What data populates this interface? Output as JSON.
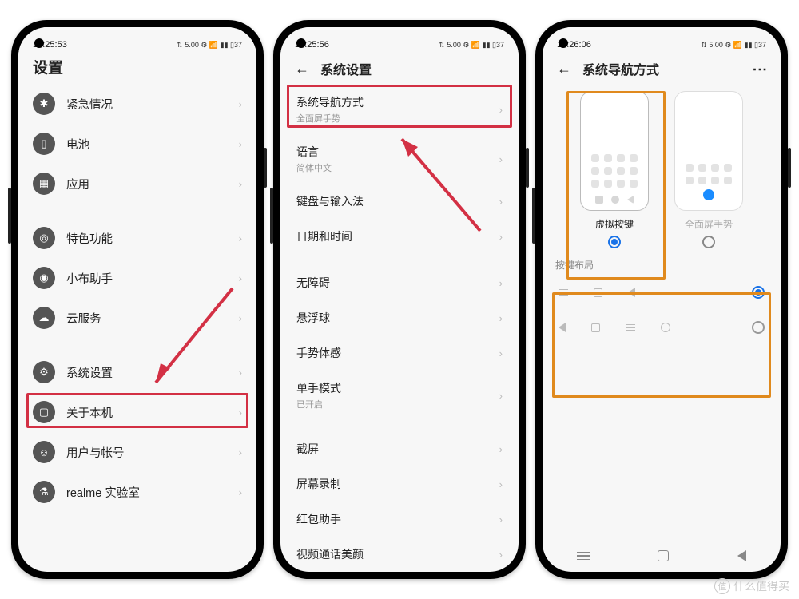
{
  "status": {
    "t1": "13:25:53",
    "t2": "13:25:56",
    "t3": "13:26:06",
    "icons": "⇅ 5.00 ⚙ 📶 ▮▮ ▯37"
  },
  "p1": {
    "title": "设置",
    "items": [
      {
        "icon": "✱",
        "label": "紧急情况"
      },
      {
        "icon": "▯",
        "label": "电池"
      },
      {
        "icon": "▦",
        "label": "应用"
      },
      {
        "icon": "◎",
        "label": "特色功能"
      },
      {
        "icon": "◉",
        "label": "小布助手"
      },
      {
        "icon": "☁",
        "label": "云服务"
      },
      {
        "icon": "⚙",
        "label": "系统设置"
      },
      {
        "icon": "▢",
        "label": "关于本机"
      },
      {
        "icon": "☺",
        "label": "用户与帐号"
      },
      {
        "icon": "⚗",
        "label": "realme 实验室"
      }
    ]
  },
  "p2": {
    "title": "系统设置",
    "items": [
      {
        "label": "系统导航方式",
        "sub": "全面屏手势"
      },
      {
        "label": "语言",
        "sub": "简体中文"
      },
      {
        "label": "键盘与输入法"
      },
      {
        "label": "日期和时间"
      },
      {
        "label": "无障碍"
      },
      {
        "label": "悬浮球"
      },
      {
        "label": "手势体感"
      },
      {
        "label": "单手模式",
        "sub": "已开启"
      },
      {
        "label": "截屏"
      },
      {
        "label": "屏幕录制"
      },
      {
        "label": "红包助手"
      },
      {
        "label": "视频通话美颜"
      }
    ]
  },
  "p3": {
    "title": "系统导航方式",
    "opt1": "虚拟按键",
    "opt2": "全面屏手势",
    "section": "按键布局"
  },
  "watermark": "什么值得买"
}
